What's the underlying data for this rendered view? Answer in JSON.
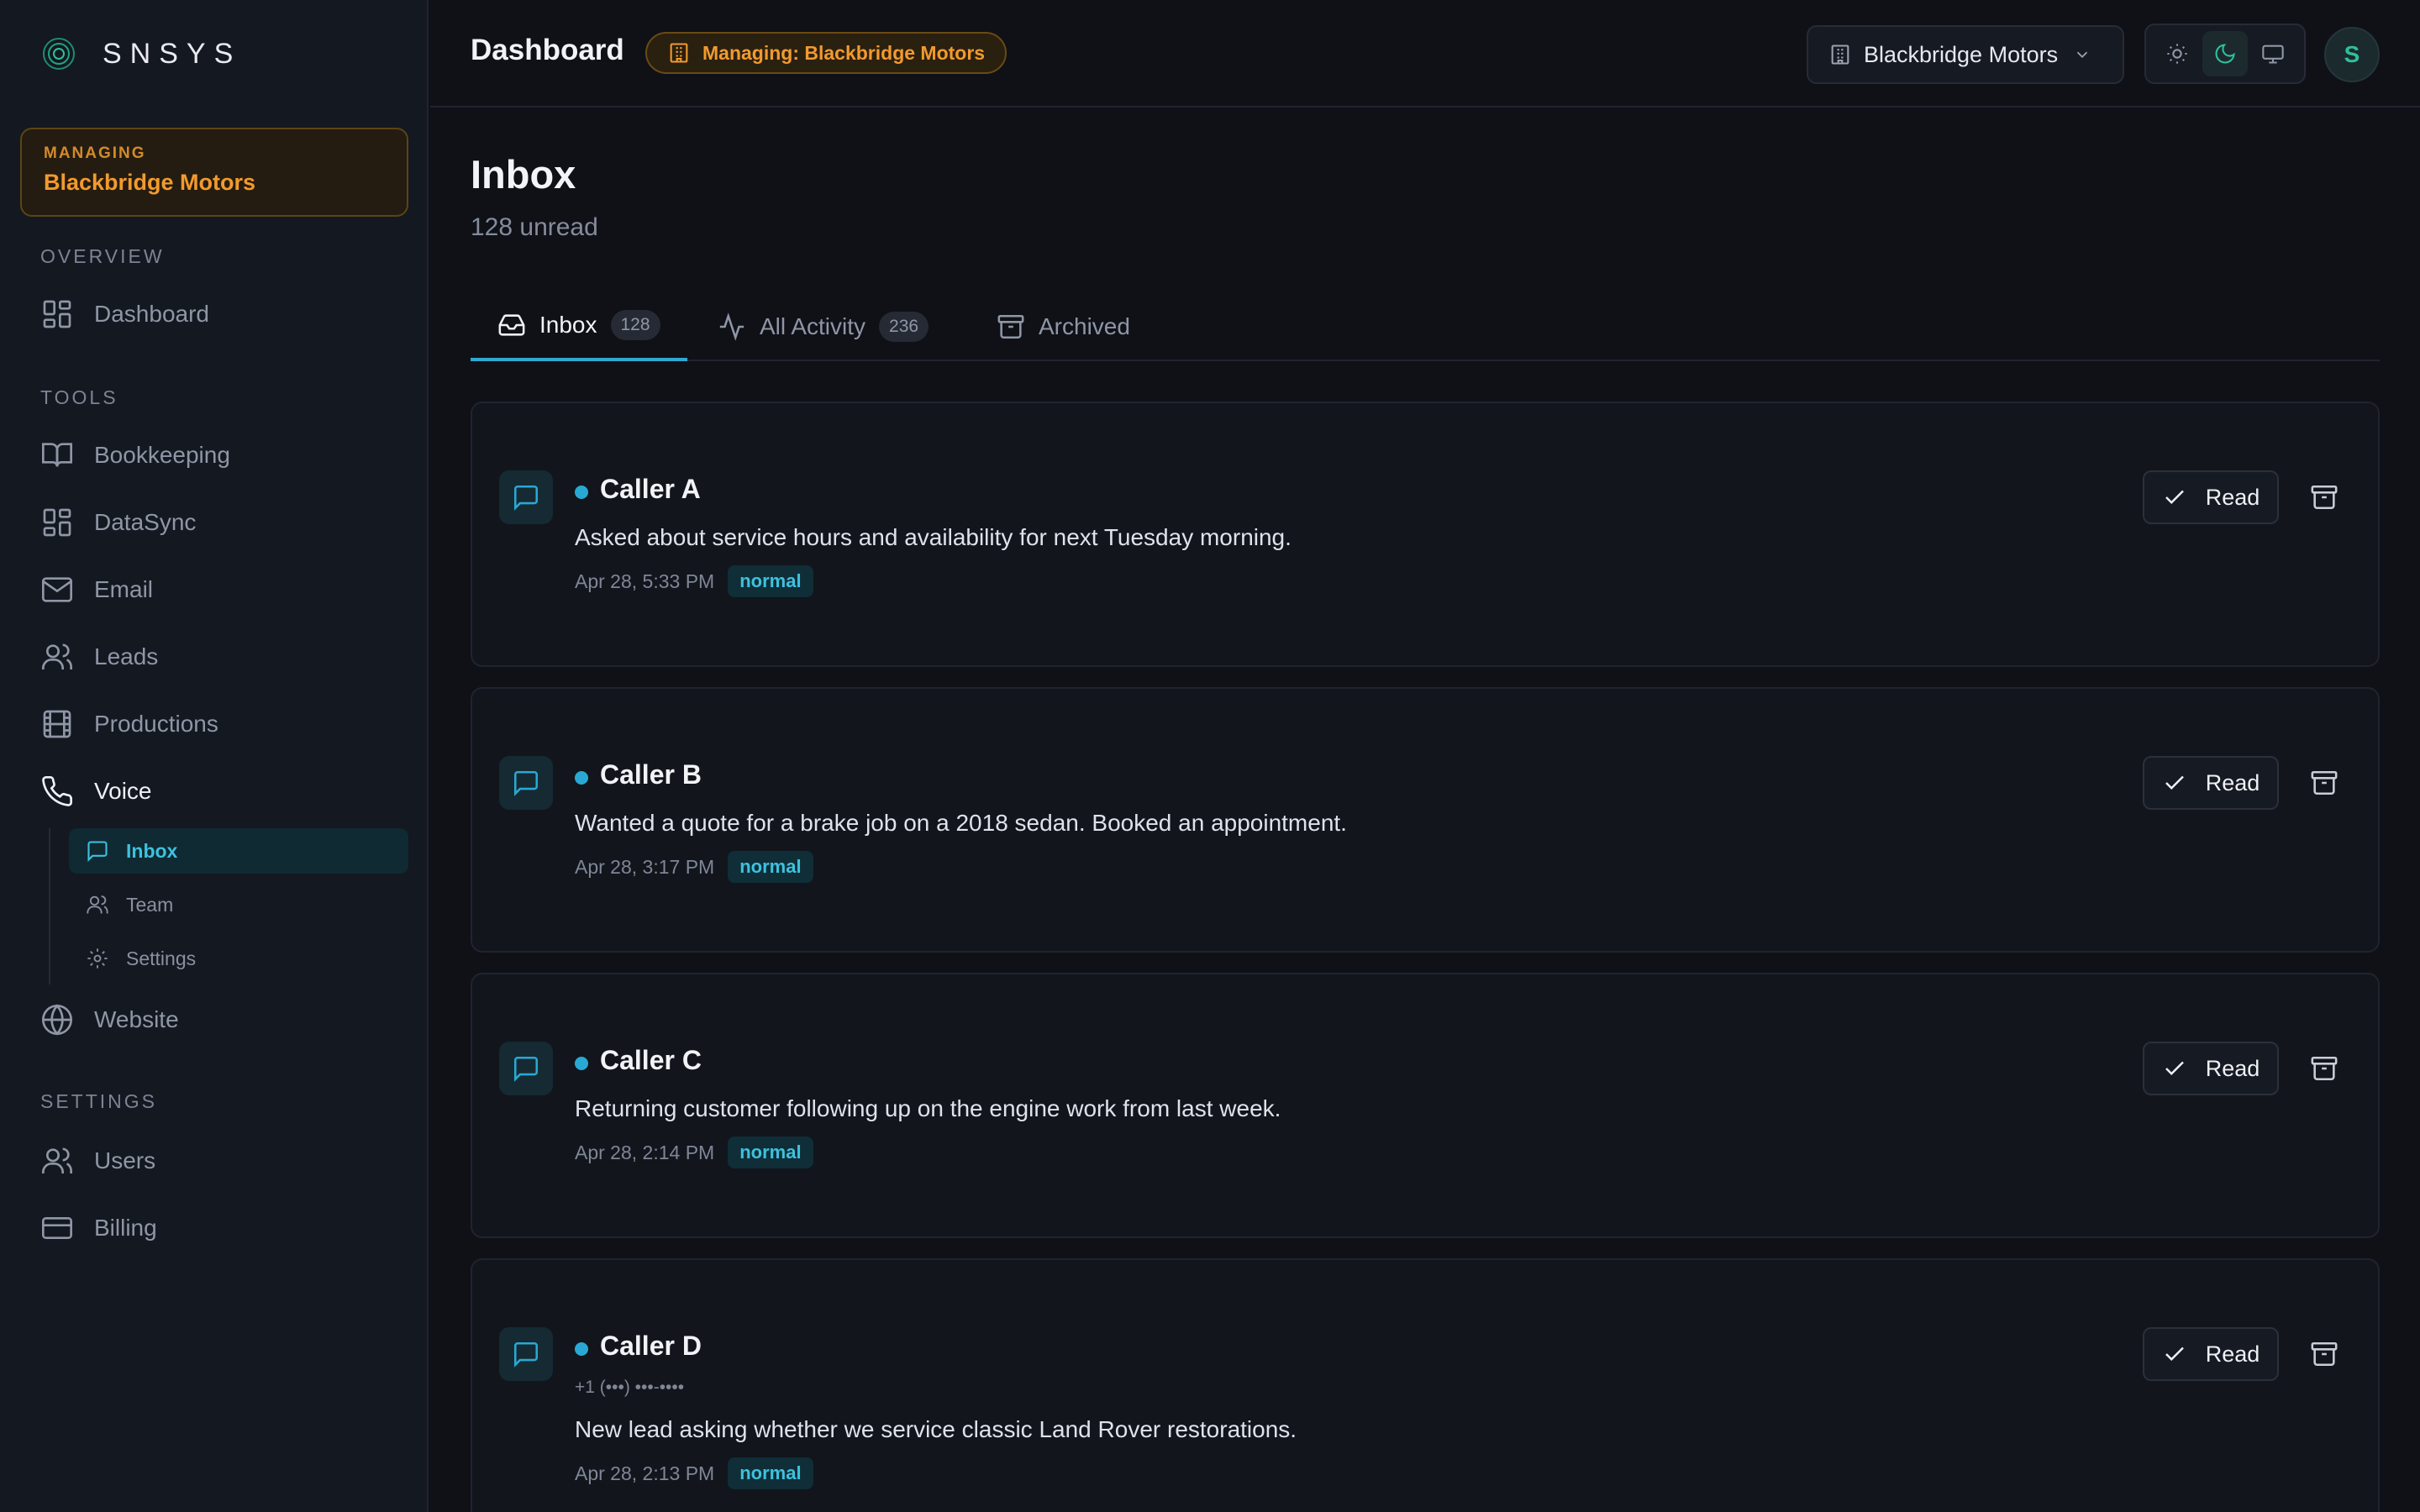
{
  "brand": {
    "name": "SNSYS"
  },
  "managing": {
    "label": "MANAGING",
    "value": "Blackbridge Motors",
    "pill": "Managing: Blackbridge Motors"
  },
  "sidebar": {
    "overview_label": "OVERVIEW",
    "tools_label": "TOOLS",
    "settings_label": "SETTINGS",
    "dashboard": "Dashboard",
    "tools": [
      "Bookkeeping",
      "DataSync",
      "Email",
      "Leads",
      "Productions",
      "Voice"
    ],
    "voice_sub": [
      "Inbox",
      "Team",
      "Settings"
    ],
    "website": "Website",
    "settings": [
      "Users",
      "Billing"
    ]
  },
  "header": {
    "title": "Dashboard",
    "org": "Blackbridge Motors",
    "avatar": "S"
  },
  "page": {
    "title": "Inbox",
    "subtitle": "128 unread"
  },
  "tabs": [
    {
      "label": "Inbox",
      "count": "128"
    },
    {
      "label": "All Activity",
      "count": "236"
    },
    {
      "label": "Archived"
    }
  ],
  "messages": [
    {
      "caller": "Caller A",
      "text": "Asked about service hours and availability for next Tuesday morning.",
      "time": "Apr 28, 5:33 PM",
      "badge": "normal",
      "action": "Read"
    },
    {
      "caller": "Caller B",
      "text": "Wanted a quote for a brake job on a 2018 sedan. Booked an appointment.",
      "time": "Apr 28, 3:17 PM",
      "badge": "normal",
      "action": "Read"
    },
    {
      "caller": "Caller C",
      "text": "Returning customer following up on the engine work from last week.",
      "time": "Apr 28, 2:14 PM",
      "badge": "normal",
      "action": "Read"
    },
    {
      "caller": "Caller D",
      "phone": "+1 (•••) •••-••••",
      "text": "New lead asking whether we service classic Land Rover restorations.",
      "time": "Apr 28, 2:13 PM",
      "badge": "normal",
      "action": "Read"
    }
  ],
  "colors": {
    "accent": "#2fa9cf",
    "managing": "#f29a2e",
    "background": "#0f1117"
  }
}
